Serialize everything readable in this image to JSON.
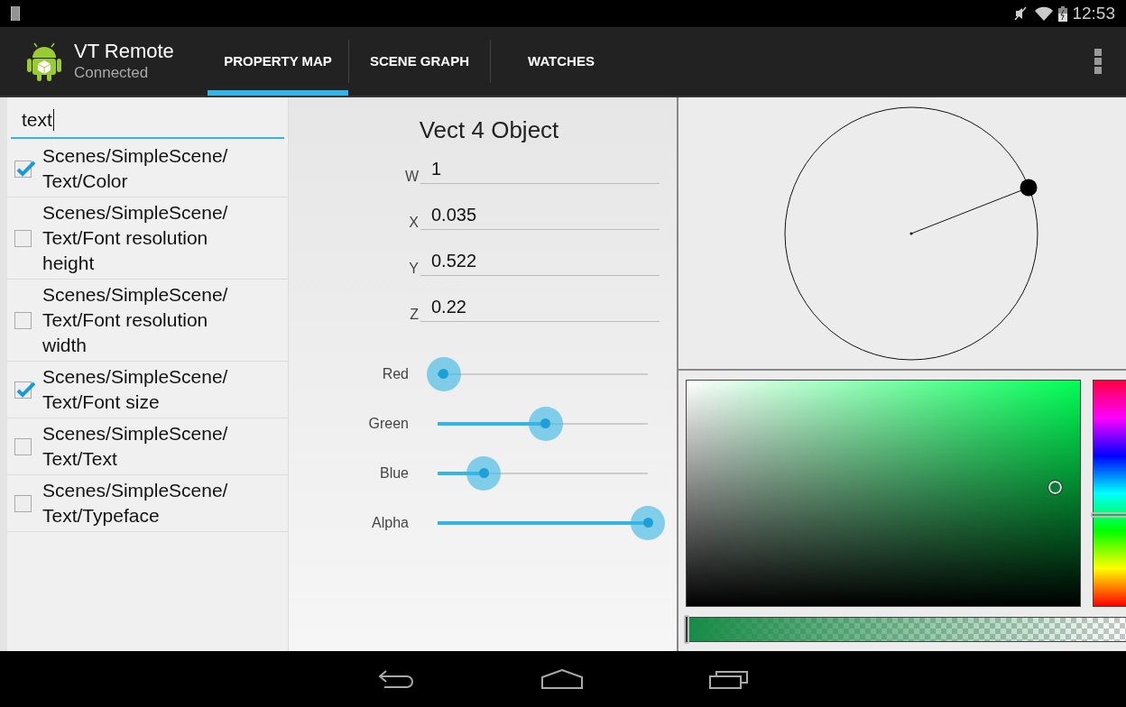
{
  "status_bar": {
    "time": "12:53"
  },
  "action_bar": {
    "title": "VT Remote",
    "subtitle": "Connected"
  },
  "tabs": [
    {
      "label": "PROPERTY MAP",
      "selected": true
    },
    {
      "label": "SCENE GRAPH",
      "selected": false
    },
    {
      "label": "WATCHES",
      "selected": false
    }
  ],
  "search": {
    "value": "text"
  },
  "properties": [
    {
      "path": "Scenes/SimpleScene/Text/Color",
      "checked": true
    },
    {
      "path": "Scenes/SimpleScene/Text/Font resolution height",
      "checked": false
    },
    {
      "path": "Scenes/SimpleScene/Text/Font resolution width",
      "checked": false
    },
    {
      "path": "Scenes/SimpleScene/Text/Font size",
      "checked": true
    },
    {
      "path": "Scenes/SimpleScene/Text/Text",
      "checked": false
    },
    {
      "path": "Scenes/SimpleScene/Text/Typeface",
      "checked": false
    }
  ],
  "editor": {
    "title": "Vect 4 Object",
    "fields": [
      {
        "label": "W",
        "value": "1"
      },
      {
        "label": "X",
        "value": "0.035"
      },
      {
        "label": "Y",
        "value": "0.522"
      },
      {
        "label": "Z",
        "value": "0.22"
      }
    ],
    "sliders": [
      {
        "label": "Red",
        "level": 0.03
      },
      {
        "label": "Green",
        "level": 0.515
      },
      {
        "label": "Blue",
        "level": 0.22
      },
      {
        "label": "Alpha",
        "level": 1.0
      }
    ]
  }
}
